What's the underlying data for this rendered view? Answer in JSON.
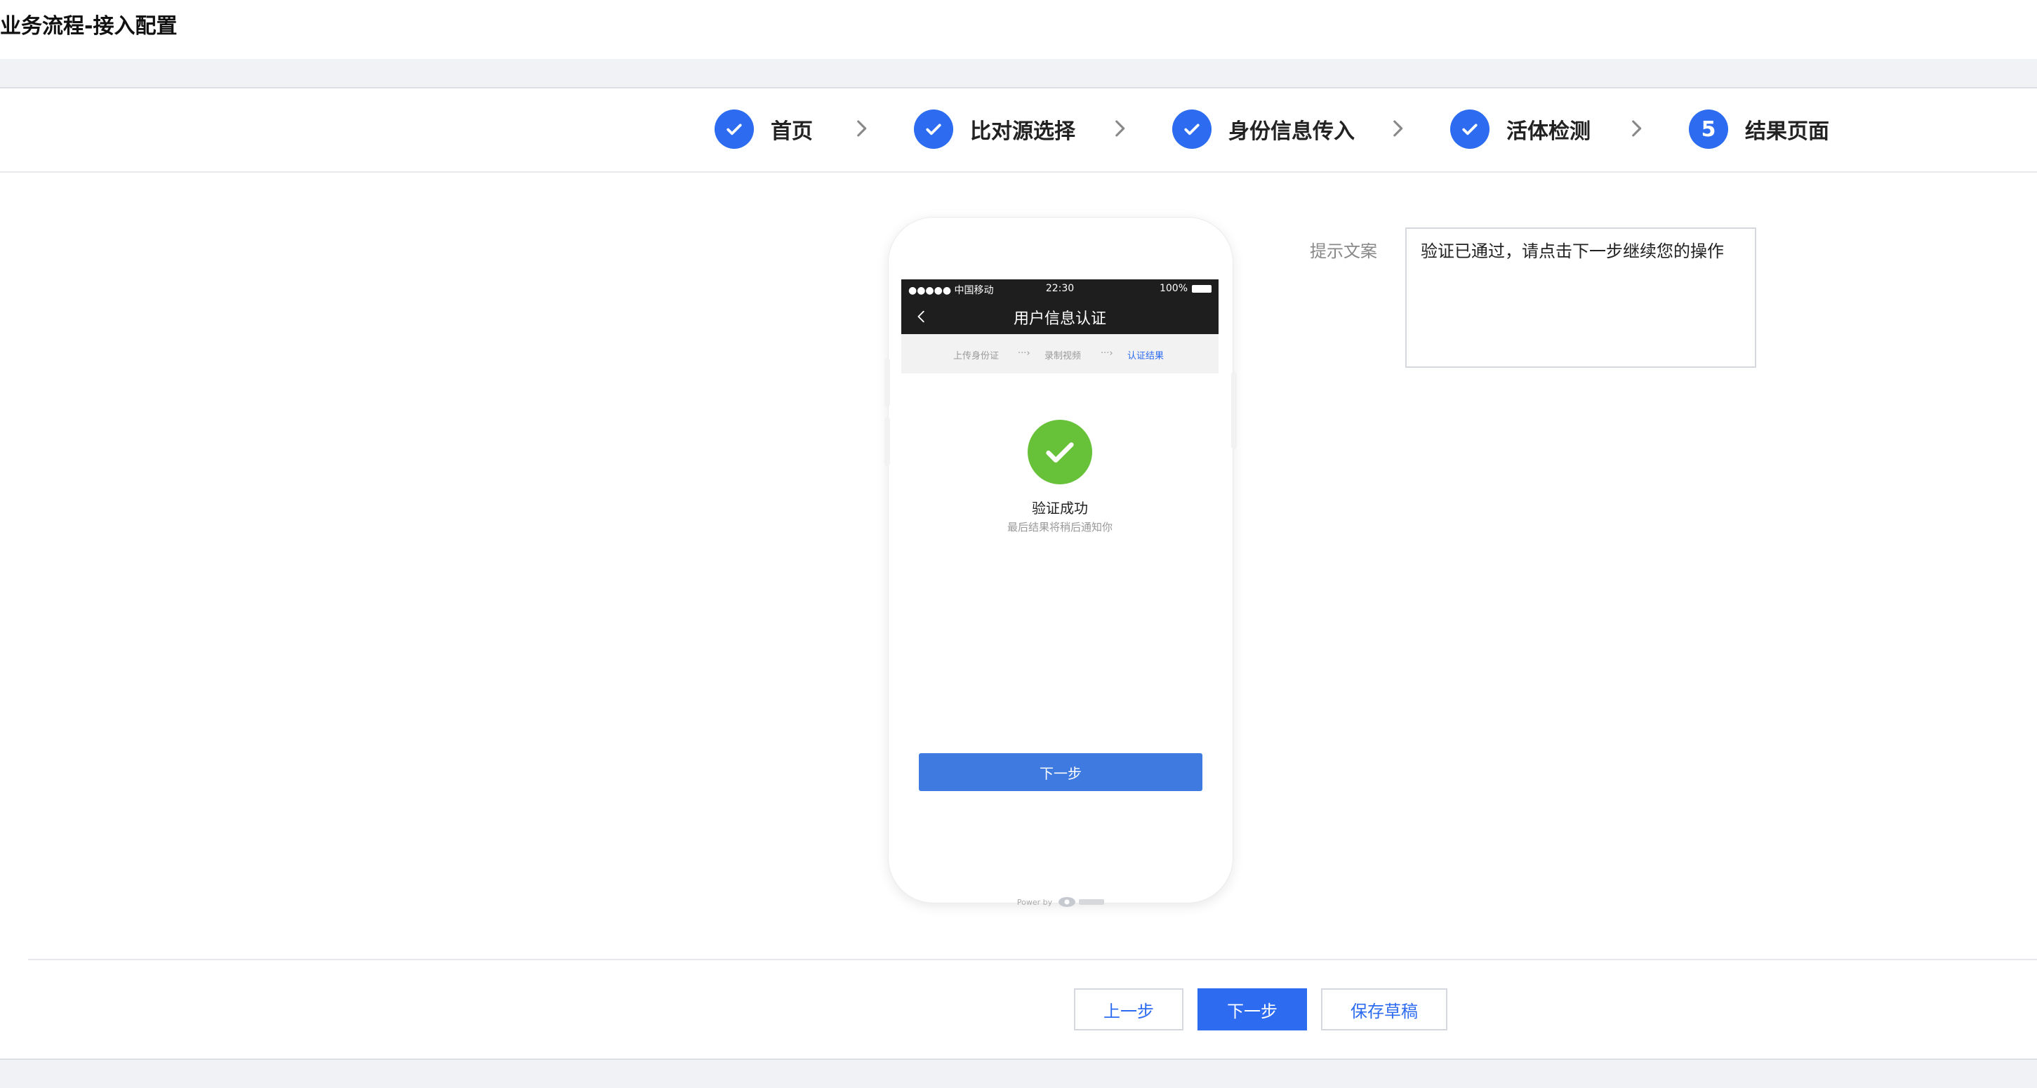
{
  "header": {
    "title": "业务流程-接入配置"
  },
  "steps": {
    "items": [
      {
        "label": "首页",
        "state": "done"
      },
      {
        "label": "比对源选择",
        "state": "done"
      },
      {
        "label": "身份信息传入",
        "state": "done"
      },
      {
        "label": "活体检测",
        "state": "done"
      },
      {
        "label": "结果页面",
        "state": "current",
        "number": "5"
      }
    ],
    "accent_color": "#2d6bf0"
  },
  "phone": {
    "status_bar": {
      "carrier": "●●●●● 中国移动",
      "time": "22:30",
      "battery": "100%"
    },
    "nav_title": "用户信息认证",
    "mini_steps": [
      "上传身份证",
      "录制视频",
      "认证结果"
    ],
    "mini_step_arrow": "···›",
    "success_title": "验证成功",
    "success_subtitle": "最后结果将稍后通知你",
    "next_button": "下一步",
    "powered_by": "Power by",
    "success_color": "#67c23a"
  },
  "prompt": {
    "label": "提示文案",
    "value": "验证已通过，请点击下一步继续您的操作"
  },
  "footer": {
    "prev_label": "上一步",
    "next_label": "下一步",
    "draft_label": "保存草稿"
  }
}
